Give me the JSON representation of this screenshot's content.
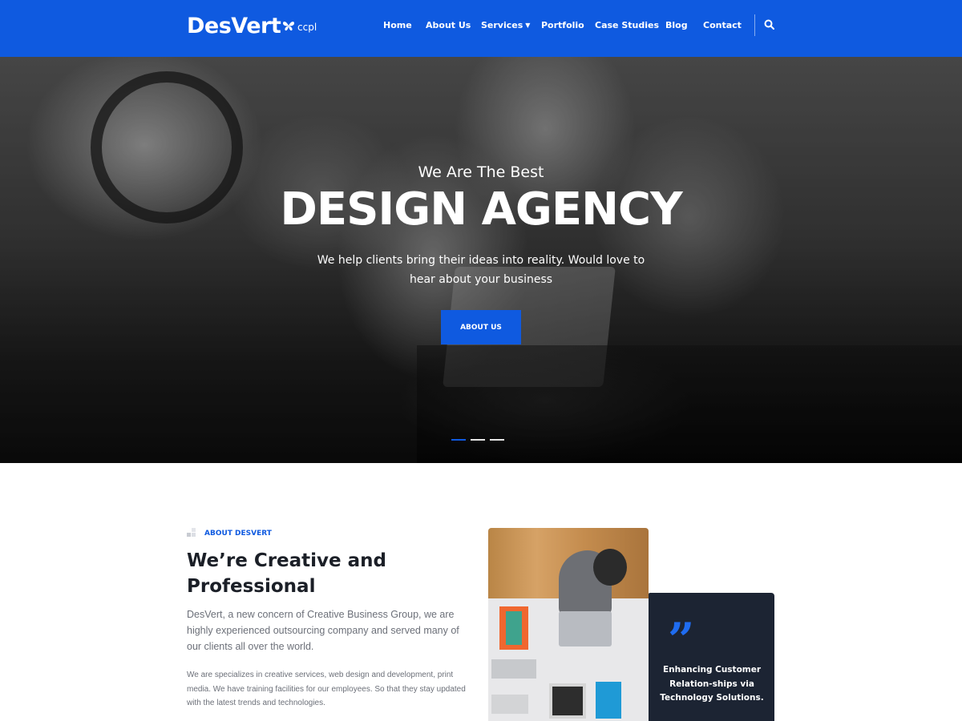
{
  "header": {
    "logo": "DesVert",
    "sublogo": "ccpl",
    "nav": [
      {
        "label": "Home"
      },
      {
        "label": "About Us"
      },
      {
        "label": "Services"
      },
      {
        "label": "Portfolio"
      },
      {
        "label": "Case Studies"
      },
      {
        "label": "Blog"
      },
      {
        "label": "Contact"
      }
    ],
    "services_caret_icon": "chevron-down-icon",
    "search_icon": "search-icon"
  },
  "hero": {
    "eyebrow": "We Are The Best",
    "title": "DESIGN AGENCY",
    "description": "We help clients bring their ideas into reality. Would love to hear about your business",
    "button_label": "ABOUT US",
    "slides": 3,
    "active_slide": 1
  },
  "about": {
    "eyebrow": "ABOUT DESVERT",
    "title": "We’re Creative and Professional",
    "lead": "DesVert, a new concern of Creative Business Group, we are highly experienced outsourcing company and served many of our clients all over the world.",
    "body": "We are specializes in creative services, web design and development, print media. We have training facilities for our employees. So that they stay updated with the latest trends and technologies."
  },
  "quote_card": {
    "mark": "”",
    "text": "Enhancing Customer Relation-ships via Technology Solutions."
  },
  "colors": {
    "brand_blue": "#0f5ae0",
    "dark_card": "#1c2433",
    "quote_blue": "#1f6cf0"
  }
}
